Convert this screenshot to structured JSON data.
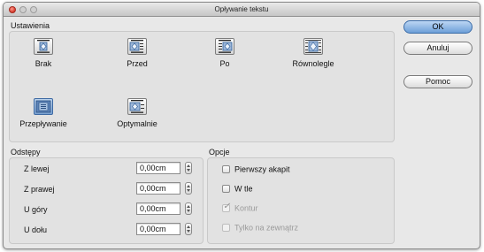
{
  "window": {
    "title": "Opływanie tekstu"
  },
  "settings": {
    "label": "Ustawienia",
    "wrap_options": [
      {
        "label": "Brak",
        "icon": "wrap-none-icon",
        "selected": false
      },
      {
        "label": "Przed",
        "icon": "wrap-before-icon",
        "selected": false
      },
      {
        "label": "Po",
        "icon": "wrap-after-icon",
        "selected": false
      },
      {
        "label": "Równolegle",
        "icon": "wrap-parallel-icon",
        "selected": false
      },
      {
        "label": "Przepływanie",
        "icon": "wrap-through-icon",
        "selected": true
      },
      {
        "label": "Optymalnie",
        "icon": "wrap-optimal-icon",
        "selected": false
      }
    ]
  },
  "spacing": {
    "label": "Odstępy",
    "fields": [
      {
        "label": "Z lewej",
        "value": "0,00cm"
      },
      {
        "label": "Z prawej",
        "value": "0,00cm"
      },
      {
        "label": "U góry",
        "value": "0,00cm"
      },
      {
        "label": "U dołu",
        "value": "0,00cm"
      }
    ]
  },
  "options": {
    "label": "Opcje",
    "items": [
      {
        "label": "Pierwszy akapit",
        "checked": false,
        "enabled": true
      },
      {
        "label": "W tle",
        "checked": false,
        "enabled": true
      },
      {
        "label": "Kontur",
        "checked": true,
        "enabled": false
      },
      {
        "label": "Tylko na zewnątrz",
        "checked": false,
        "enabled": false
      }
    ]
  },
  "buttons": {
    "ok": "OK",
    "cancel": "Anuluj",
    "help": "Pomoc"
  },
  "colors": {
    "default_button": "#6d9fd8",
    "selected_option": "#7aa2d2",
    "close_button": "#d6392b"
  }
}
